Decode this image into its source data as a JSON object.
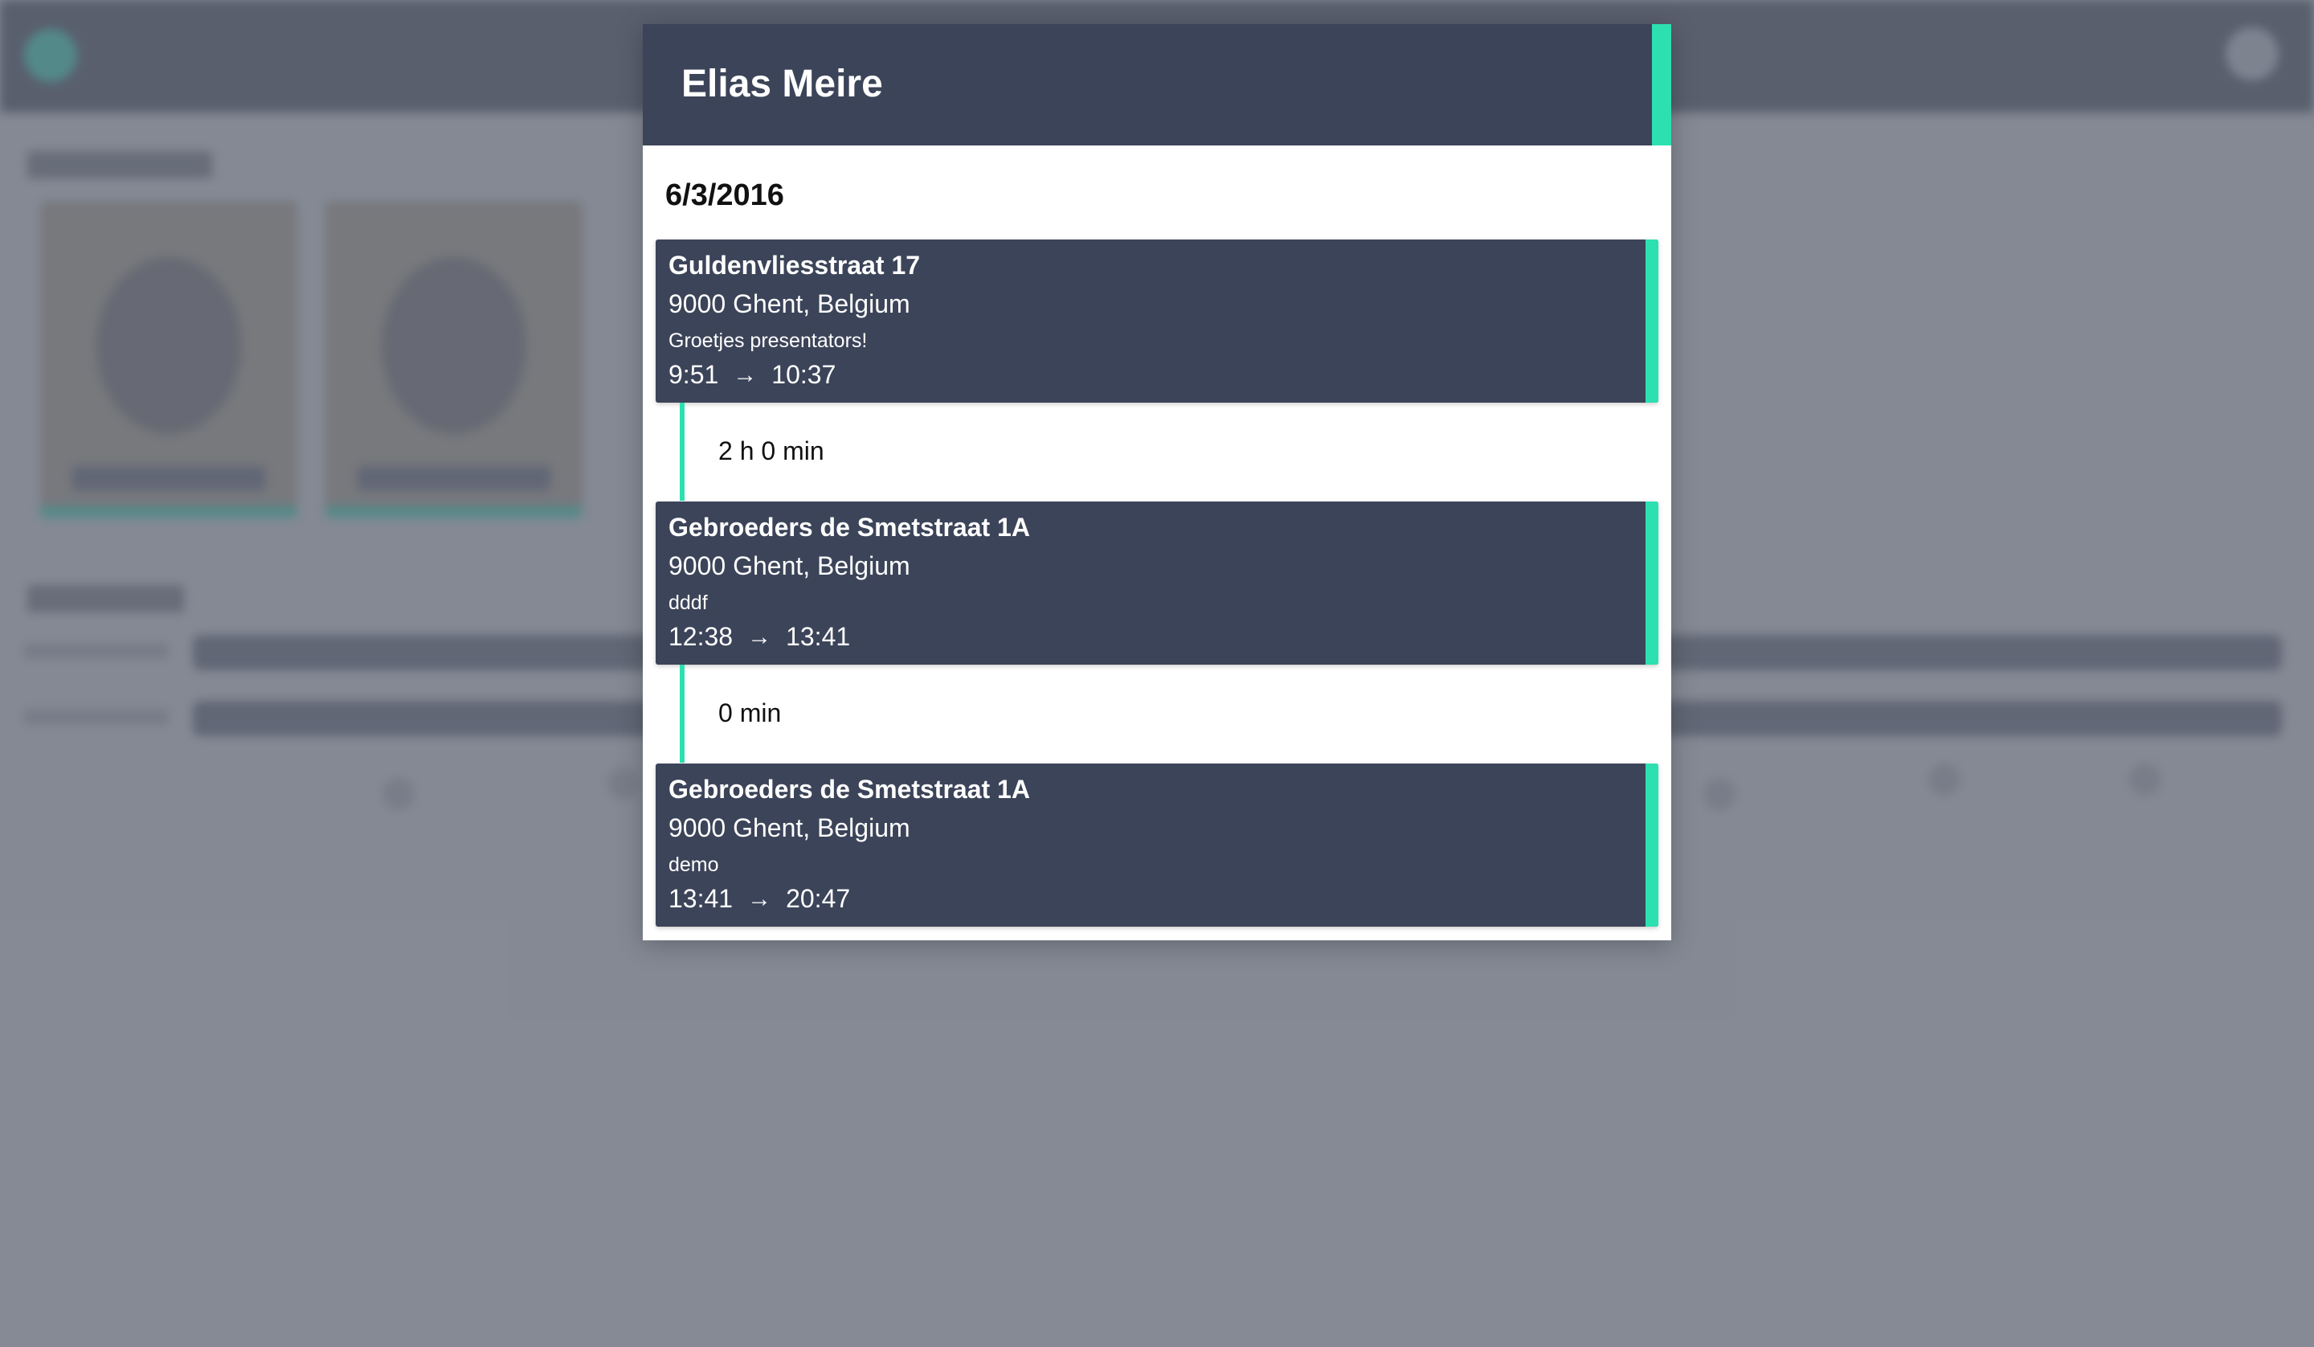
{
  "modal": {
    "title": "Elias Meire",
    "date": "6/3/2016"
  },
  "visits": [
    {
      "street": "Guldenvliesstraat 17",
      "city": "9000 Ghent, Belgium",
      "note": "Groetjes presentators!",
      "start": "9:51",
      "end": "10:37"
    },
    {
      "street": "Gebroeders de Smetstraat 1A",
      "city": "9000 Ghent, Belgium",
      "note": "dddf",
      "start": "12:38",
      "end": "13:41"
    },
    {
      "street": "Gebroeders de Smetstraat 1A",
      "city": "9000 Ghent, Belgium",
      "note": "demo",
      "start": "13:41",
      "end": "20:47"
    }
  ],
  "gaps": [
    {
      "duration": "2 h 0 min"
    },
    {
      "duration": "0 min"
    }
  ],
  "icons": {
    "arrow": "→"
  },
  "colors": {
    "accent": "#2de0b0",
    "card": "#3c4459",
    "backdrop": "#8a8f99"
  }
}
